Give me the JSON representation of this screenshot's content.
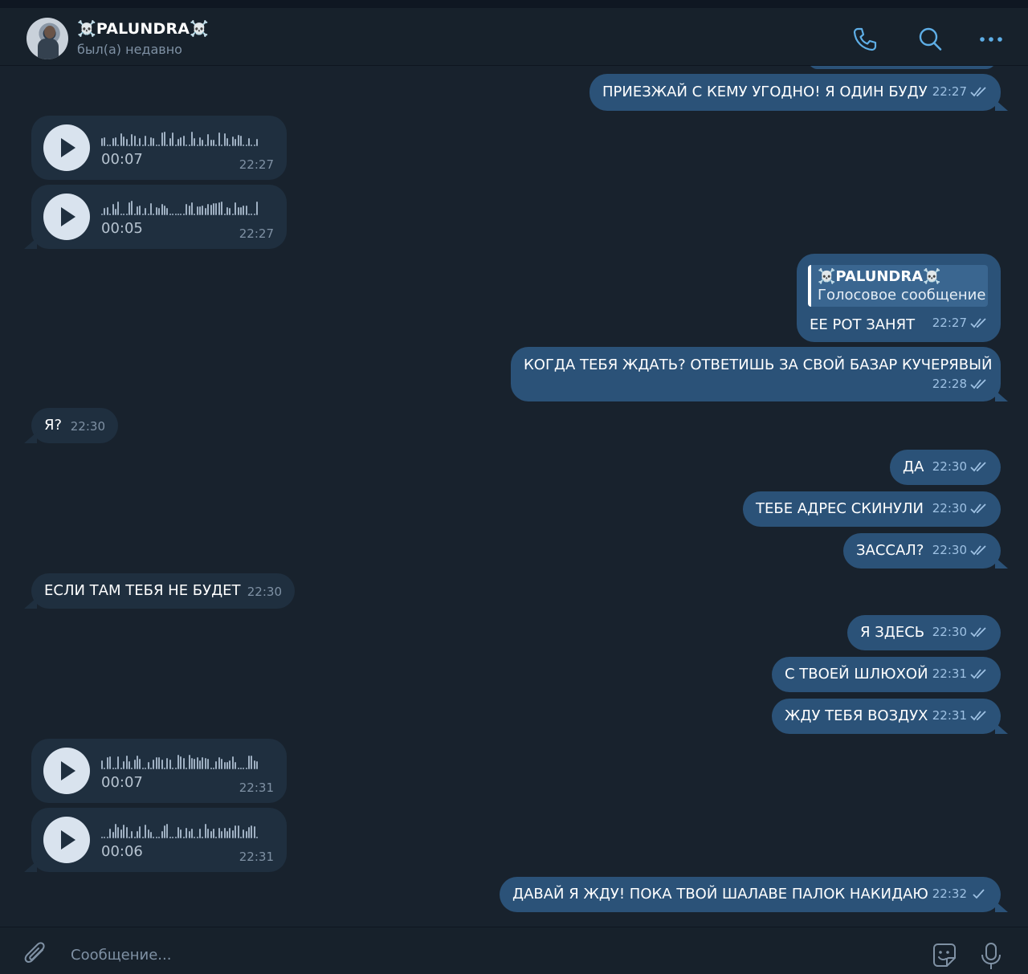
{
  "header": {
    "title": "☠️PALUNDRA☠️",
    "status": "был(а) недавно",
    "icons": [
      "phone-icon",
      "search-icon",
      "more-icon"
    ]
  },
  "colors": {
    "background": "#18222d",
    "outgoing_bubble": "#2b5278",
    "incoming_bubble": "#1f2f3f",
    "accent": "#5eaee6",
    "time_out": "#9ec1e3",
    "time_in": "#7f91a4"
  },
  "messages": [
    {
      "dir": "out",
      "type": "text",
      "text": "ПРИЕЗЖАЙ С КЕМУ УГОДНО! Я ОДИН БУДУ",
      "time": "22:27",
      "status": "read"
    },
    {
      "dir": "in",
      "type": "voice",
      "duration": "00:07",
      "time": "22:27"
    },
    {
      "dir": "in",
      "type": "voice",
      "duration": "00:05",
      "time": "22:27"
    },
    {
      "dir": "out",
      "type": "reply",
      "reply_name": "☠️PALUNDRA☠️",
      "reply_text": "Голосовое сообщение",
      "text": "ЕЕ РОТ ЗАНЯТ",
      "time": "22:27",
      "status": "read"
    },
    {
      "dir": "out",
      "type": "text",
      "text": "КОГДА ТЕБЯ ЖДАТЬ? ОТВЕТИШЬ ЗА СВОЙ БАЗАР КУЧЕРЯВЫЙ",
      "time": "22:28",
      "status": "read"
    },
    {
      "dir": "in",
      "type": "text",
      "text": "Я?",
      "time": "22:30"
    },
    {
      "dir": "out",
      "type": "text",
      "text": "ДА",
      "time": "22:30",
      "status": "read"
    },
    {
      "dir": "out",
      "type": "text",
      "text": "ТЕБЕ АДРЕС СКИНУЛИ",
      "time": "22:30",
      "status": "read"
    },
    {
      "dir": "out",
      "type": "text",
      "text": "ЗАССАЛ?",
      "time": "22:30",
      "status": "read"
    },
    {
      "dir": "in",
      "type": "text",
      "text": "ЕСЛИ ТАМ ТЕБЯ НЕ БУДЕТ",
      "time": "22:30"
    },
    {
      "dir": "out",
      "type": "text",
      "text": "Я ЗДЕСЬ",
      "time": "22:30",
      "status": "read"
    },
    {
      "dir": "out",
      "type": "text",
      "text": "С ТВОЕЙ ШЛЮХОЙ",
      "time": "22:31",
      "status": "read"
    },
    {
      "dir": "out",
      "type": "text",
      "text": "ЖДУ ТЕБЯ ВОЗДУХ",
      "time": "22:31",
      "status": "read"
    },
    {
      "dir": "in",
      "type": "voice",
      "duration": "00:07",
      "time": "22:31"
    },
    {
      "dir": "in",
      "type": "voice",
      "duration": "00:06",
      "time": "22:31"
    },
    {
      "dir": "out",
      "type": "text",
      "text": "ДАВАЙ Я ЖДУ! ПОКА ТВОЙ ШАЛАВЕ ПАЛОК НАКИДАЮ",
      "time": "22:32",
      "status": "sent"
    }
  ],
  "composer": {
    "placeholder": "Сообщение...",
    "icons": [
      "attach-icon",
      "sticker-icon",
      "microphone-icon"
    ]
  }
}
